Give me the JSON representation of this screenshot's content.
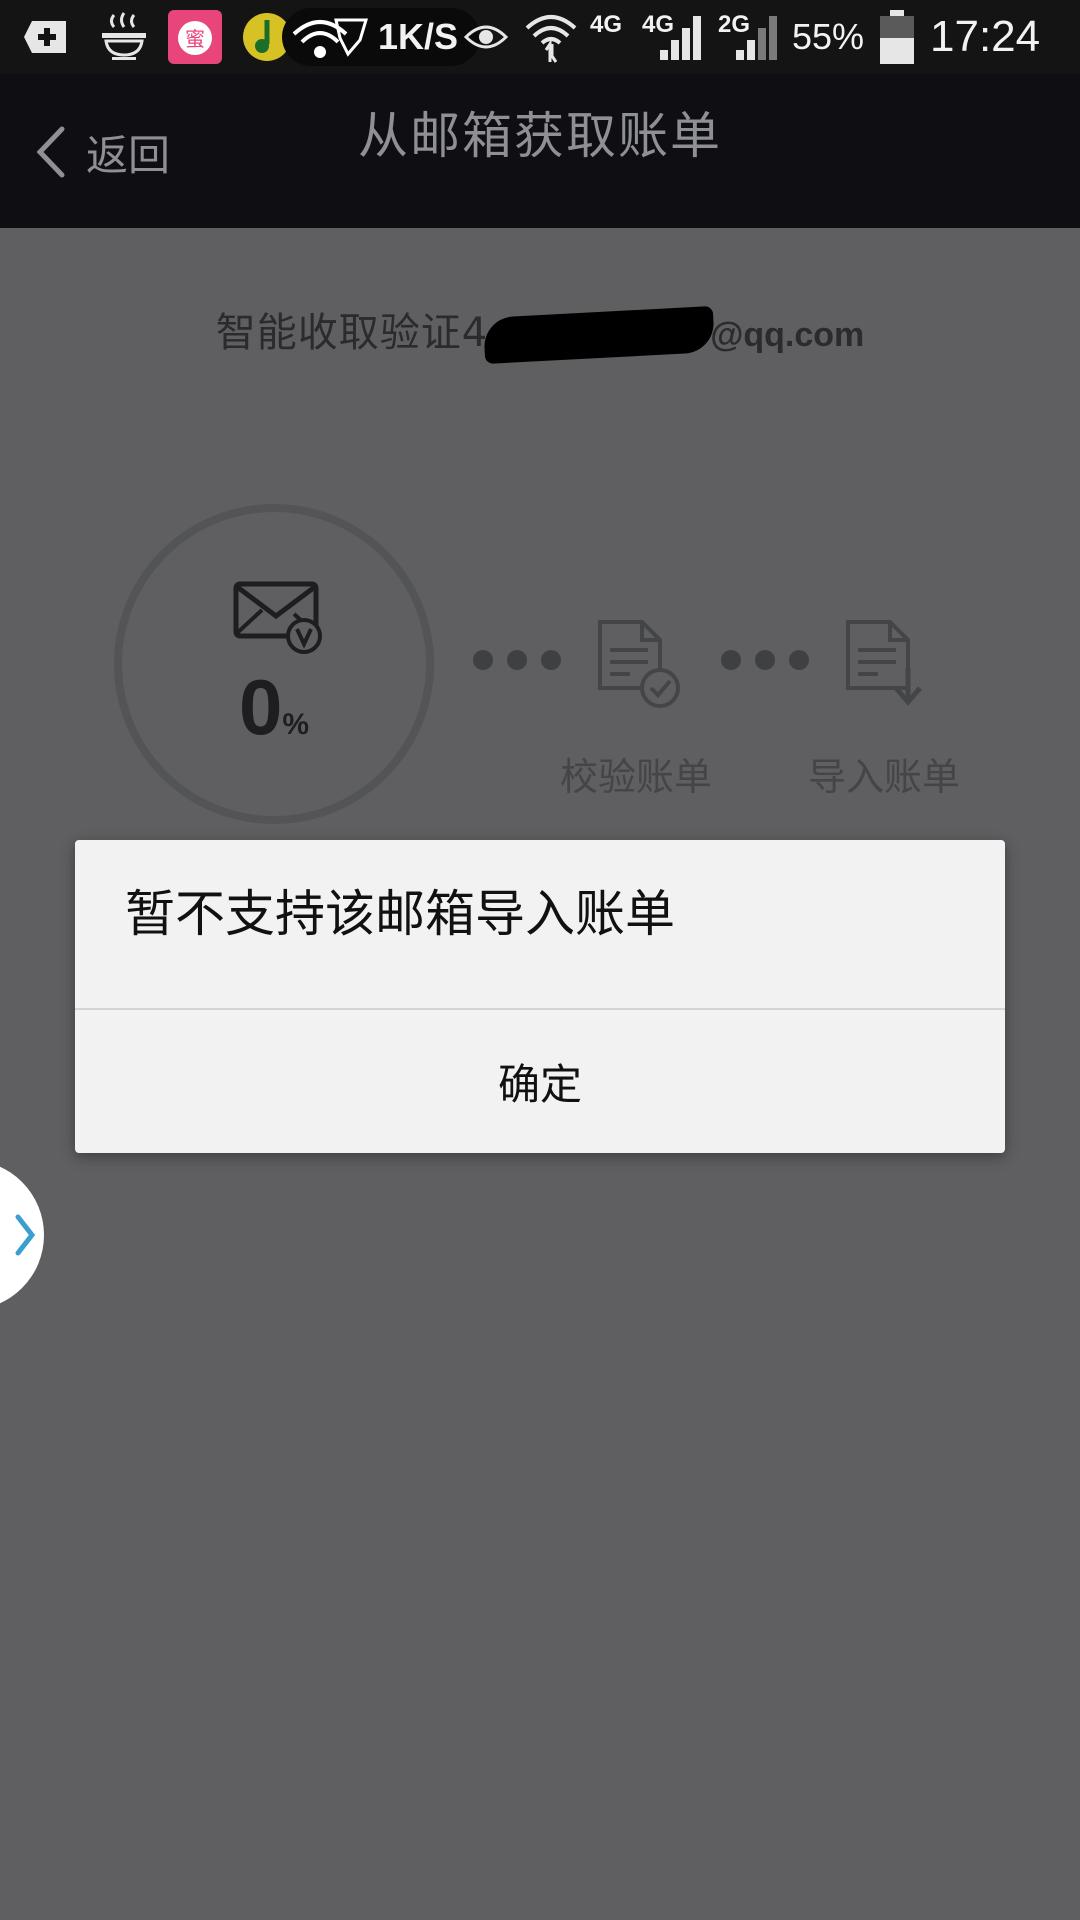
{
  "status_bar": {
    "net_speed": "1K/S",
    "network_4g_a": "4G",
    "network_4g_b": "4G",
    "network_2g": "2G",
    "battery": "55%",
    "time": "17:24",
    "icons": [
      "plus-box-icon",
      "steam-bowl-icon",
      "pink-app-icon",
      "music-app-icon",
      "wifi-shield-icon",
      "eye-icon",
      "wifi-icon",
      "signal-icon",
      "battery-icon"
    ]
  },
  "header": {
    "back_label": "返回",
    "title": "从邮箱获取账单"
  },
  "progress": {
    "verify_prefix": "智能收取验证4",
    "email_suffix": "@qq.com",
    "percent": "0",
    "percent_unit": "%",
    "steps": [
      {
        "label": "校验账单",
        "icon": "document-check-icon"
      },
      {
        "label": "导入账单",
        "icon": "document-download-icon"
      }
    ]
  },
  "dialog": {
    "message": "暂不支持该邮箱导入账单",
    "ok_label": "确定"
  },
  "colors": {
    "overlay_bg": "#5f5f62",
    "titlebar_bg": "#0f0f13",
    "dialog_bg": "#f2f2f2",
    "handle_arrow": "#3a9fd0"
  }
}
